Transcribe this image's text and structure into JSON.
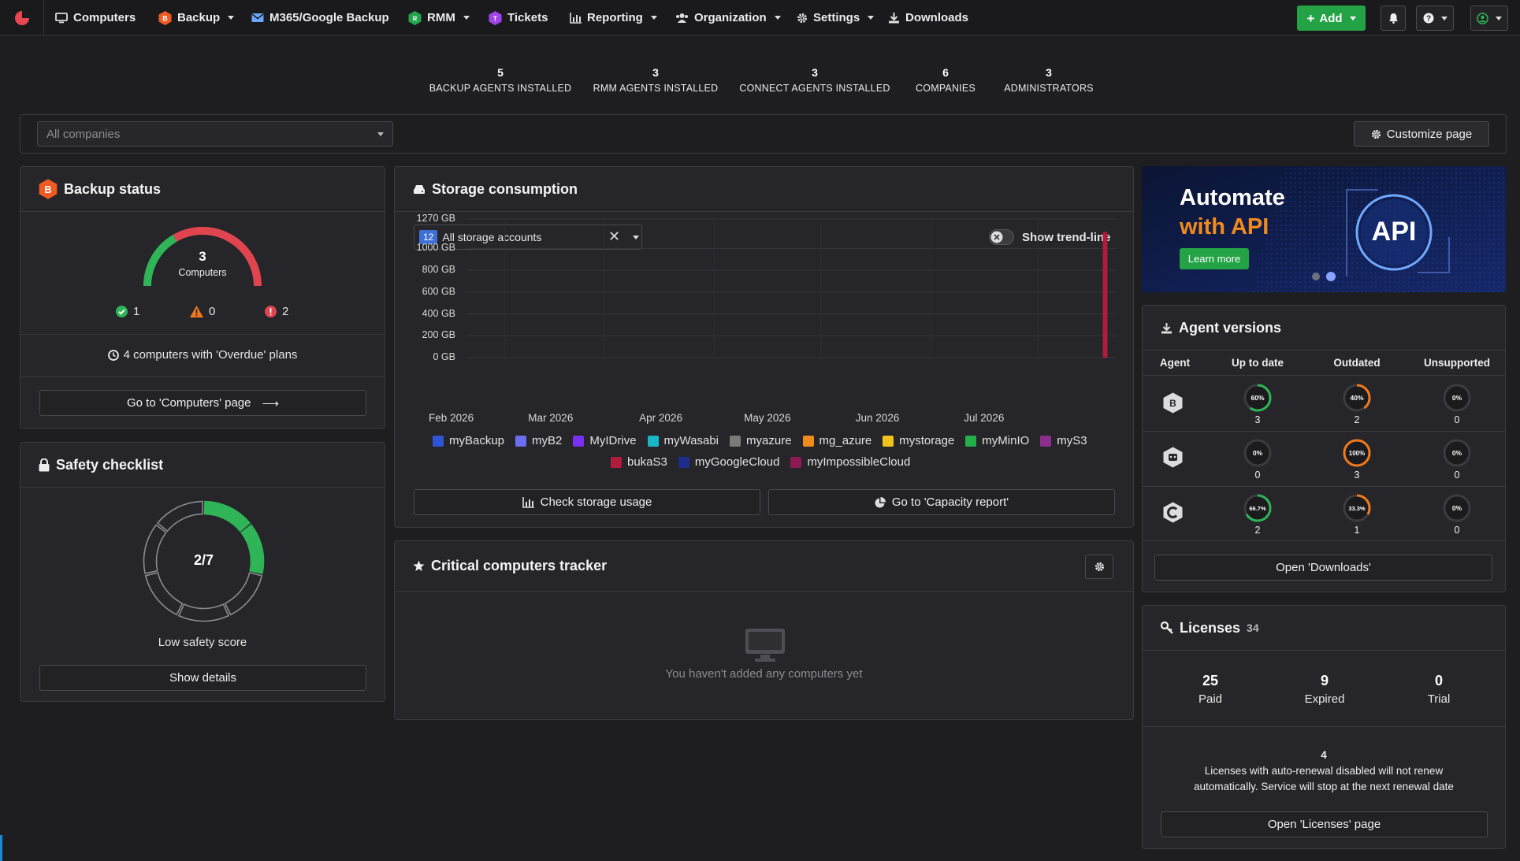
{
  "nav": {
    "items": [
      {
        "label": "Computers",
        "icon": "monitor-icon",
        "caret": false
      },
      {
        "label": "Backup",
        "icon": "backup-logo-icon",
        "caret": true
      },
      {
        "label": "M365/Google Backup",
        "icon": "envelope-icon",
        "caret": false
      },
      {
        "label": "RMM",
        "icon": "rmm-logo-icon",
        "caret": true
      },
      {
        "label": "Tickets",
        "icon": "tickets-logo-icon",
        "caret": false
      },
      {
        "label": "Reporting",
        "icon": "bar-chart-icon",
        "caret": true
      },
      {
        "label": "Organization",
        "icon": "users-icon",
        "caret": true
      },
      {
        "label": "Settings",
        "icon": "gear-icon",
        "caret": true
      },
      {
        "label": "Downloads",
        "icon": "download-icon",
        "caret": false
      }
    ],
    "add_label": "Add"
  },
  "stats": [
    {
      "value": "5",
      "label": "BACKUP AGENTS INSTALLED"
    },
    {
      "value": "3",
      "label": "RMM AGENTS INSTALLED"
    },
    {
      "value": "3",
      "label": "CONNECT AGENTS INSTALLED"
    },
    {
      "value": "6",
      "label": "COMPANIES"
    },
    {
      "value": "3",
      "label": "ADMINISTRATORS"
    }
  ],
  "filter": {
    "company_placeholder": "All companies",
    "customize_label": "Customize page"
  },
  "backup_status": {
    "title": "Backup status",
    "gauge_count": "3",
    "gauge_label": "Computers",
    "ok_count": "1",
    "warning_count": "0",
    "error_count": "2",
    "overdue_text": "4 computers with 'Overdue' plans",
    "button": "Go to 'Computers' page",
    "colors": {
      "ok": "#2fb457",
      "error": "#e0454f"
    }
  },
  "safety": {
    "title": "Safety checklist",
    "score": "2/7",
    "passed": 2,
    "total": 7,
    "status": "Low safety score",
    "button": "Show details"
  },
  "storage": {
    "title": "Storage consumption",
    "account_count": "12",
    "account_select": "All storage accounts",
    "trend_label": "Show trend-line",
    "check_button": "Check storage usage",
    "capacity_button": "Go to 'Capacity report'"
  },
  "chart_data": {
    "type": "bar",
    "title": "",
    "y_tick_labels": [
      "1270 GB",
      "1000 GB",
      "800 GB",
      "600 GB",
      "400 GB",
      "200 GB",
      "0 GB"
    ],
    "y_ticks": [
      1270,
      1000,
      800,
      600,
      400,
      200,
      0
    ],
    "ylim": [
      0,
      1270
    ],
    "x_tick_labels": [
      "Feb 2026",
      "Mar 2026",
      "Apr 2026",
      "May 2026",
      "Jun 2026",
      "Jul 2026"
    ],
    "x_range": [
      "2026-01-21",
      "2026-07-23"
    ],
    "series": [
      {
        "name": "myBackup",
        "color": "#2f55d4"
      },
      {
        "name": "myB2",
        "color": "#6b6ef0"
      },
      {
        "name": "MyIDrive",
        "color": "#7b2ff0"
      },
      {
        "name": "myWasabi",
        "color": "#17b7c9"
      },
      {
        "name": "myazure",
        "color": "#7a7a7a"
      },
      {
        "name": "mg_azure",
        "color": "#f08a1c"
      },
      {
        "name": "mystorage",
        "color": "#f1c21b"
      },
      {
        "name": "myMinIO",
        "color": "#22b04a"
      },
      {
        "name": "myS3",
        "color": "#8c2f8c"
      },
      {
        "name": "bukaS3",
        "color": "#b01c3a"
      },
      {
        "name": "myGoogleCloud",
        "color": "#1e2c8c"
      },
      {
        "name": "myImpossibleCloud",
        "color": "#8e1a55"
      }
    ],
    "bars": [
      {
        "date": "2026-07-20",
        "series": "bukaS3",
        "value": 1150
      }
    ],
    "grid": true,
    "legend": "bottom"
  },
  "tracker": {
    "title": "Critical computers tracker",
    "empty_text": "You haven't added any computers yet"
  },
  "promo": {
    "line1": "Automate",
    "line2": "with API",
    "badge": "API",
    "button": "Learn more"
  },
  "agents": {
    "title": "Agent versions",
    "headers": [
      "Agent",
      "Up to date",
      "Outdated",
      "Unsupported"
    ],
    "rows": [
      {
        "icon": "backup-agent-icon",
        "cells": [
          {
            "pct": "60%",
            "value": 60,
            "count": "3"
          },
          {
            "pct": "40%",
            "value": 40,
            "count": "2"
          },
          {
            "pct": "0%",
            "value": 0,
            "count": "0"
          }
        ]
      },
      {
        "icon": "rmm-agent-icon",
        "cells": [
          {
            "pct": "0%",
            "value": 0,
            "count": "0"
          },
          {
            "pct": "100%",
            "value": 100,
            "count": "3"
          },
          {
            "pct": "0%",
            "value": 0,
            "count": "0"
          }
        ]
      },
      {
        "icon": "connect-agent-icon",
        "cells": [
          {
            "pct": "66.7%",
            "value": 66.7,
            "count": "2"
          },
          {
            "pct": "33.3%",
            "value": 33.3,
            "count": "1"
          },
          {
            "pct": "0%",
            "value": 0,
            "count": "0"
          }
        ]
      }
    ],
    "colors": {
      "uptodate": "#2fb457",
      "outdated": "#f07a1c"
    },
    "button": "Open 'Downloads'"
  },
  "licenses": {
    "title": "Licenses",
    "total": "34",
    "paid": "25",
    "paid_label": "Paid",
    "expired": "9",
    "expired_label": "Expired",
    "trial": "0",
    "trial_label": "Trial",
    "autorenew_count": "4",
    "autorenew_line1": "Licenses with auto-renewal disabled will not renew",
    "autorenew_line2": "automatically. Service will stop at the next renewal date",
    "button": "Open 'Licenses' page"
  }
}
